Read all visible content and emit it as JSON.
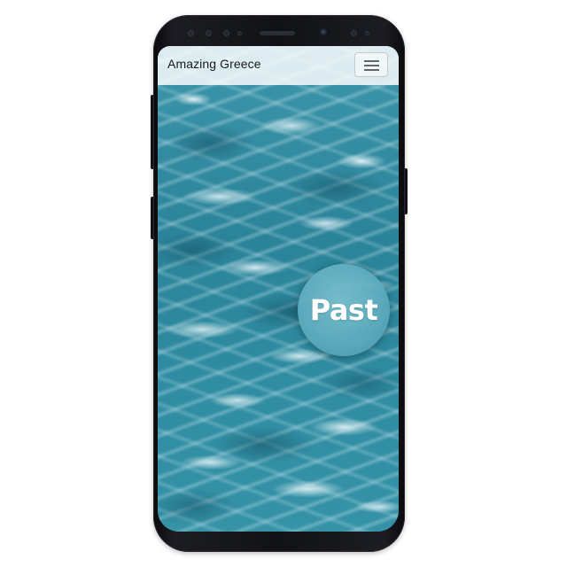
{
  "app": {
    "title": "Amazing Greece"
  },
  "header": {
    "menu_icon": "hamburger-menu-icon"
  },
  "hero": {
    "background": "sea-waves",
    "badge_label": "Past"
  },
  "colors": {
    "sea": "#2d8aa0",
    "badge": "#5aaabc",
    "header_bg": "#ffffff"
  }
}
